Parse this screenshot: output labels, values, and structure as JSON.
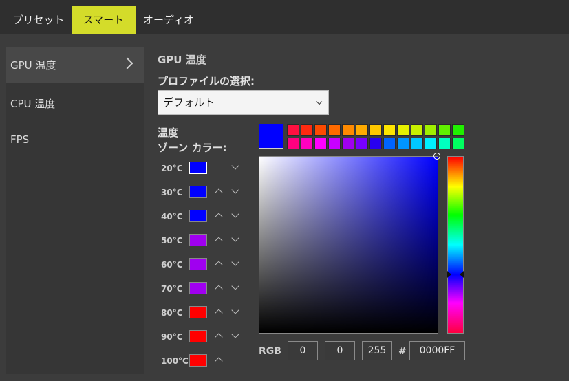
{
  "tabs": [
    {
      "label": "プリセット",
      "active": false
    },
    {
      "label": "スマート",
      "active": true
    },
    {
      "label": "オーディオ",
      "active": false
    }
  ],
  "sidebar": {
    "items": [
      {
        "label": "GPU 温度",
        "active": true
      },
      {
        "label": "CPU 温度",
        "active": false
      },
      {
        "label": "FPS",
        "active": false
      }
    ]
  },
  "main": {
    "title": "GPU 温度",
    "profile_label": "プロファイルの選択:",
    "profile_value": "デフォルト",
    "zone_label_line1": "温度",
    "zone_label_line2": "ゾーン カラー:",
    "zones": [
      {
        "temp": "20°C",
        "color": "#0000FF",
        "selected": true
      },
      {
        "temp": "30°C",
        "color": "#0000FF"
      },
      {
        "temp": "40°C",
        "color": "#0000FF"
      },
      {
        "temp": "50°C",
        "color": "#A000F0"
      },
      {
        "temp": "60°C",
        "color": "#A000F0"
      },
      {
        "temp": "70°C",
        "color": "#A000F0"
      },
      {
        "temp": "80°C",
        "color": "#FF0000"
      },
      {
        "temp": "90°C",
        "color": "#FF0000"
      },
      {
        "temp": "100°C",
        "color": "#FF0000"
      }
    ]
  },
  "color_picker": {
    "current_color": "#0000FF",
    "presets_row1": [
      "#FF1040",
      "#FF2A10",
      "#FF4A00",
      "#FF6A00",
      "#FF8A00",
      "#FFAA00",
      "#FFC800",
      "#FFE600",
      "#E6F000",
      "#C8F000",
      "#A0F000",
      "#60F000",
      "#20F000"
    ],
    "presets_row2": [
      "#FF0080",
      "#FF00C0",
      "#FF00FF",
      "#C800FF",
      "#A000F0",
      "#7800FF",
      "#2800F0",
      "#0064FF",
      "#0096FF",
      "#00C8FF",
      "#00F0FF",
      "#00FFC0",
      "#00FF60"
    ],
    "rgb_label": "RGB",
    "r": "0",
    "g": "0",
    "b": "255",
    "hash_label": "#",
    "hex": "0000FF"
  }
}
